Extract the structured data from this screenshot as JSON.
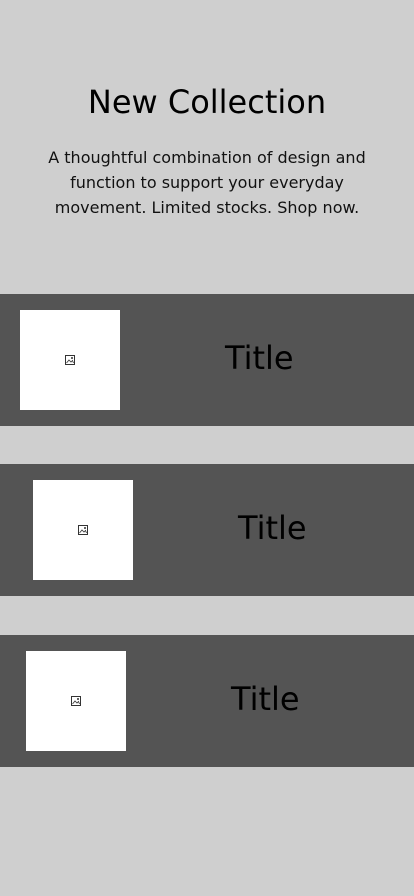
{
  "hero": {
    "title": "New Collection",
    "description": "A thoughtful combination of design and function to support your everyday movement. Limited stocks. Shop now."
  },
  "cards": [
    {
      "title": "Title",
      "image_icon": "image-placeholder-icon"
    },
    {
      "title": "Title",
      "image_icon": "image-placeholder-icon"
    },
    {
      "title": "Title",
      "image_icon": "image-placeholder-icon"
    }
  ],
  "colors": {
    "background": "#cfcfcf",
    "card_background": "#545454",
    "thumbnail_background": "#ffffff",
    "text": "#000000"
  }
}
